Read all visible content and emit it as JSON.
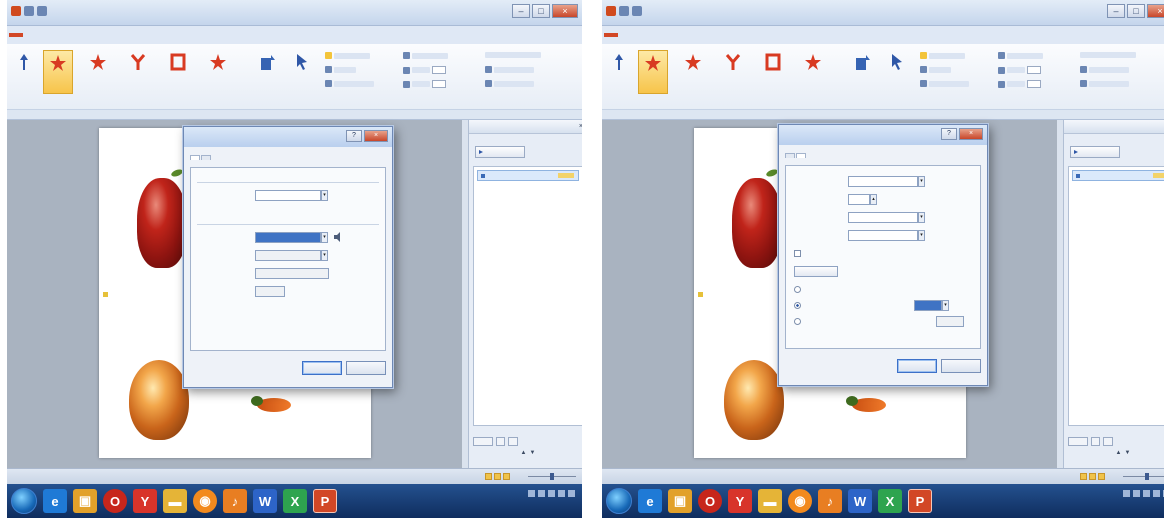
{
  "screens": [
    {
      "id": "left",
      "window_title": "",
      "tabs": [
        "",
        "",
        "",
        "",
        "",
        "",
        "",
        "",
        ""
      ],
      "file_tab": "",
      "ribbon_buttons": [
        "",
        "",
        "",
        "",
        "",
        "",
        "",
        ""
      ],
      "dialog": {
        "title": "",
        "tabs": [
          "",
          ""
        ],
        "active_tab": 0,
        "section1": "",
        "field1_label": "",
        "field1_value": "",
        "section2": "",
        "field2_label": "",
        "field2_value": "",
        "field3_label": "",
        "field3_value": "",
        "field4_label": "",
        "ok": "",
        "cancel": ""
      },
      "task_pane": {
        "title": "",
        "play": "",
        "item": ""
      },
      "status": {
        "slide": "",
        "theme": "",
        "lang": ""
      }
    },
    {
      "id": "right",
      "window_title": "",
      "tabs": [
        "",
        "",
        "",
        "",
        "",
        "",
        "",
        "",
        ""
      ],
      "file_tab": "",
      "ribbon_buttons": [
        "",
        "",
        "",
        "",
        "",
        "",
        "",
        ""
      ],
      "dialog": {
        "title": "",
        "tabs": [
          "",
          ""
        ],
        "active_tab": 1,
        "rows": [
          {
            "label": "",
            "value": ""
          },
          {
            "label": "",
            "value": ""
          },
          {
            "label": "",
            "value": ""
          },
          {
            "label": "",
            "value": ""
          }
        ],
        "checkbox1": "",
        "trigger_button": "",
        "radio1": "",
        "radio2": "",
        "radio2_value": "",
        "radio3": "",
        "ok": "",
        "cancel": ""
      },
      "task_pane": {
        "title": "",
        "play": "",
        "item": ""
      },
      "status": {
        "slide": "",
        "theme": "",
        "lang": ""
      }
    }
  ],
  "colors": {
    "file_tab": "#d24726",
    "ribbon_active": "#f7c44a",
    "taskbar": "#1a3f78",
    "dialog_close": "#c8462a"
  },
  "icons": [
    "star-icon",
    "speaker-icon",
    "ie-icon",
    "opera-icon",
    "yandex-icon",
    "folder-icon",
    "powerpoint-icon",
    "word-icon",
    "start-icon"
  ]
}
